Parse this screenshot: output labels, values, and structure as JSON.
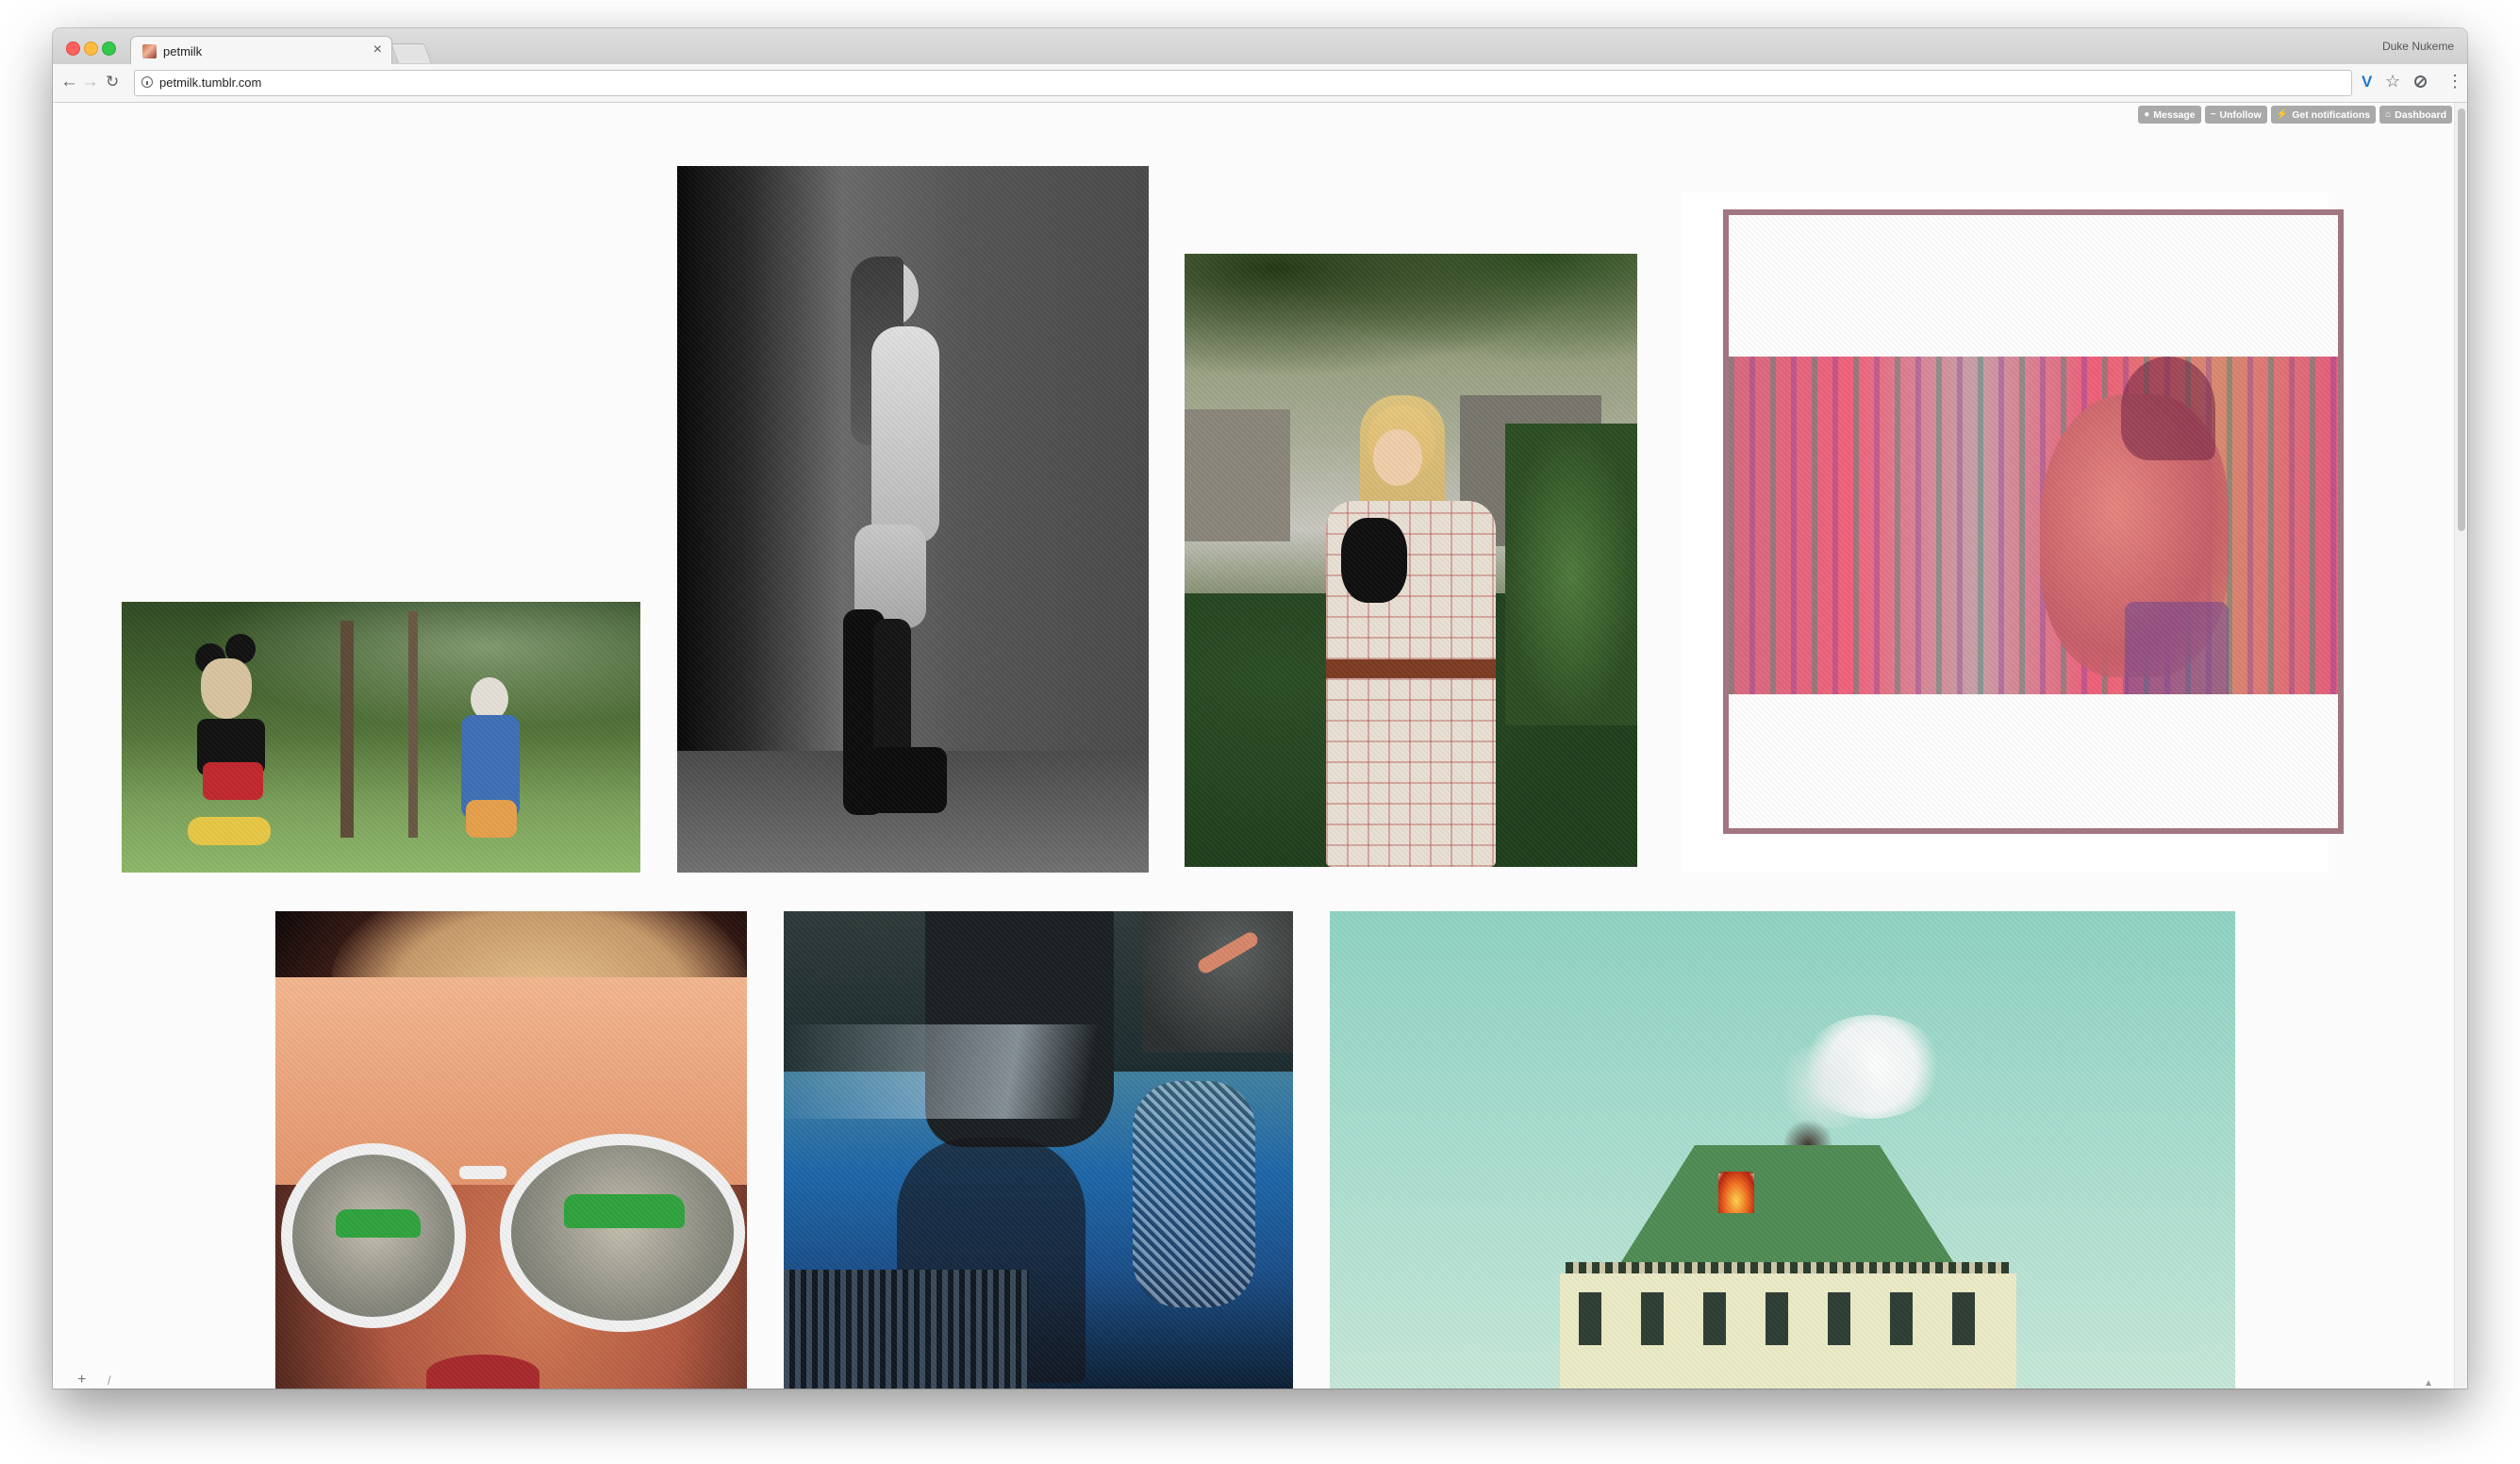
{
  "browser": {
    "tab_title": "petmilk",
    "tab_close": "×",
    "profile_name": "Duke Nukeme",
    "url": "petmilk.tumblr.com"
  },
  "nav": {
    "back_glyph": "←",
    "forward_glyph": "→",
    "reload_glyph": "↻",
    "extension_label": "V",
    "bookmark_glyph": "☆",
    "menu_glyph": "⋮"
  },
  "tumblr_controls": [
    {
      "label": "Message",
      "icon": "message-icon",
      "glyph": "●"
    },
    {
      "label": "Unfollow",
      "icon": "unfollow-icon",
      "glyph": "−"
    },
    {
      "label": "Get notifications",
      "icon": "notifications-icon",
      "glyph": "⚡"
    },
    {
      "label": "Dashboard",
      "icon": "dashboard-icon",
      "glyph": "⌂"
    }
  ],
  "posts": [
    {
      "name": "photo-cartoon-statues"
    },
    {
      "name": "photo-bw-figure"
    },
    {
      "name": "photo-woman-with-cat"
    },
    {
      "name": "photo-glitch-portrait"
    },
    {
      "name": "photo-sunglasses-reflection"
    },
    {
      "name": "photo-car-reflection"
    },
    {
      "name": "photo-burning-house"
    }
  ],
  "footer": {
    "plus": "+",
    "slash": "/",
    "scroll_top": "▲"
  },
  "colors": {
    "tab_strip": "#d6d6d6",
    "page_background": "#fbfbfb",
    "control_button": "#a9a9a9",
    "extension_accent": "#1e77c8"
  }
}
